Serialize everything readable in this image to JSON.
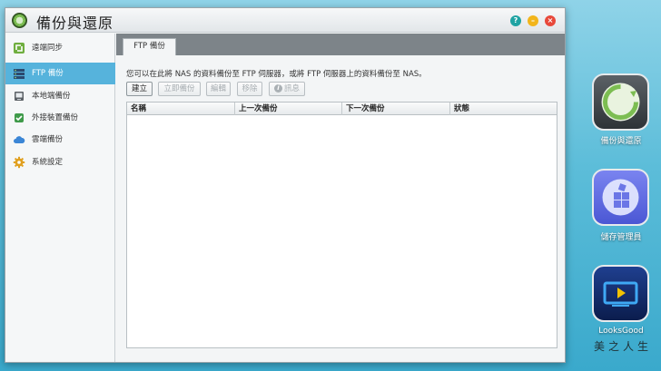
{
  "window": {
    "title": "備份與還原"
  },
  "sidebar": {
    "items": [
      {
        "label": "遠端同步",
        "icon": "remote-sync-icon"
      },
      {
        "label": "FTP 備份",
        "icon": "ftp-icon"
      },
      {
        "label": "本地端備份",
        "icon": "local-drive-icon"
      },
      {
        "label": "外接裝置備份",
        "icon": "external-device-icon"
      },
      {
        "label": "雲端備份",
        "icon": "cloud-icon"
      },
      {
        "label": "系統設定",
        "icon": "gear-icon"
      }
    ],
    "active_index": 1
  },
  "main": {
    "tab_label": "FTP 備份",
    "description": "您可以在此將 NAS 的資料備份至 FTP 伺服器，或將 FTP 伺服器上的資料備份至 NAS。",
    "toolbar": {
      "create": "建立",
      "backup_now": "立即備份",
      "edit": "編輯",
      "remove": "移除",
      "info": "訊息"
    },
    "table": {
      "columns": [
        "名稱",
        "上一次備份",
        "下一次備份",
        "狀態"
      ],
      "rows": []
    }
  },
  "desktop": {
    "icons": [
      {
        "label": "備份與還原",
        "icon": "backup-restore-icon"
      },
      {
        "label": "儲存管理員",
        "icon": "storage-manager-icon"
      },
      {
        "label": "LooksGood",
        "icon": "looksgood-icon"
      }
    ]
  },
  "colors": {
    "accent": "#56b3dc",
    "tab_strip": "#7d8489",
    "close": "#e8483a",
    "minimize": "#f2b51b",
    "help": "#1fa3a3"
  }
}
